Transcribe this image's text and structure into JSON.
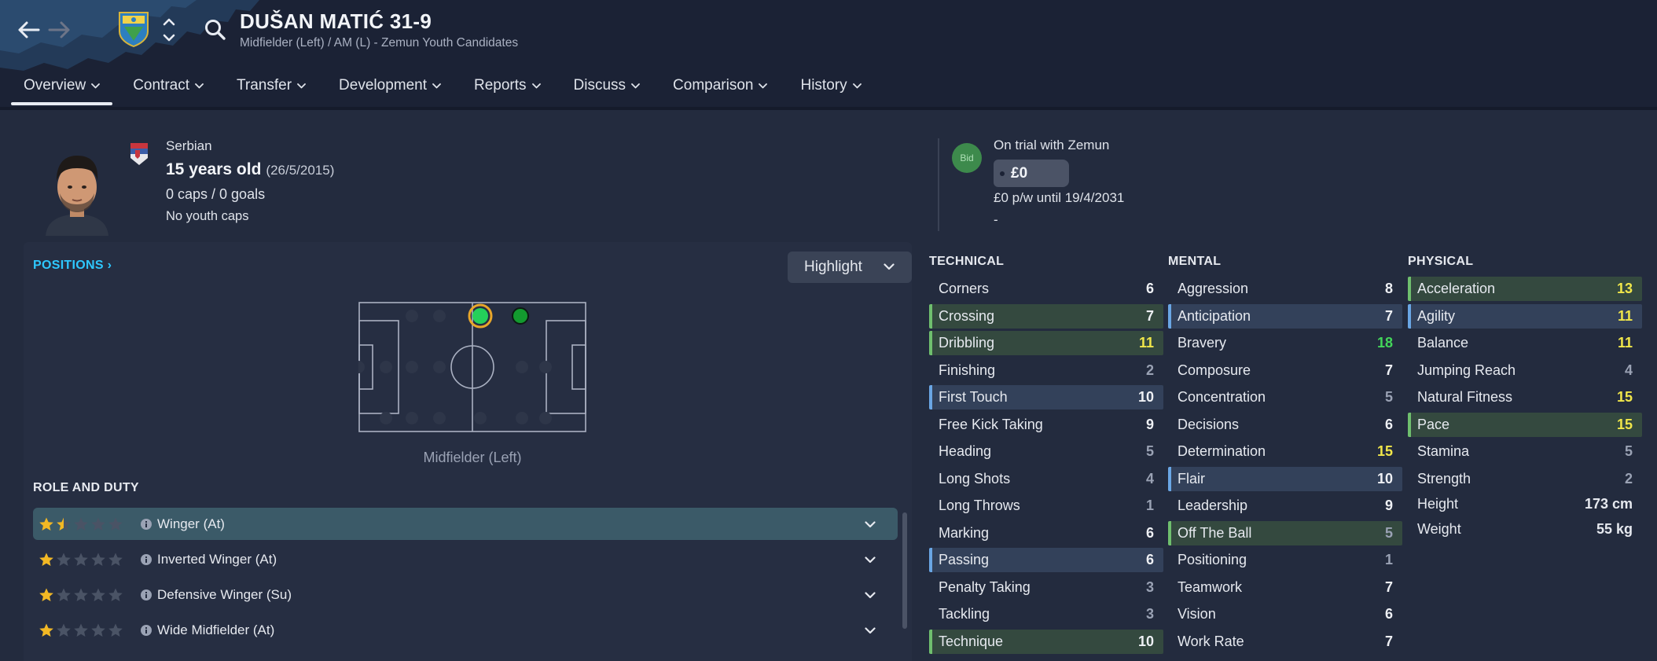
{
  "header": {
    "player_name": "DUŠAN MATIĆ 31-9",
    "subtitle": "Midfielder (Left) / AM (L) - Zemun Youth Candidates",
    "tabs": [
      {
        "label": "Overview",
        "active": true
      },
      {
        "label": "Contract"
      },
      {
        "label": "Transfer"
      },
      {
        "label": "Development"
      },
      {
        "label": "Reports"
      },
      {
        "label": "Discuss"
      },
      {
        "label": "Comparison"
      },
      {
        "label": "History"
      }
    ]
  },
  "profile": {
    "nationality": "Serbian",
    "age": "15 years old",
    "dob": "(26/5/2015)",
    "caps": "0 caps / 0 goals",
    "youth_caps": "No youth caps"
  },
  "contract": {
    "bid_label": "Bid",
    "status": "On trial with Zemun",
    "fee": "£0",
    "wage": "£0 p/w until 19/4/2031",
    "extra": "-"
  },
  "positions": {
    "title": "POSITIONS",
    "highlight_label": "Highlight",
    "current_position": "Midfielder (Left)"
  },
  "role_duty": {
    "title": "ROLE AND DUTY",
    "roles": [
      {
        "name": "Winger (At)",
        "stars": 1.5,
        "selected": true
      },
      {
        "name": "Inverted Winger (At)",
        "stars": 1
      },
      {
        "name": "Defensive Winger (Su)",
        "stars": 1
      },
      {
        "name": "Wide Midfielder (At)",
        "stars": 1
      }
    ]
  },
  "attributes": {
    "technical": {
      "title": "TECHNICAL",
      "items": [
        {
          "name": "Corners",
          "value": "6",
          "tone": "mid",
          "hl": ""
        },
        {
          "name": "Crossing",
          "value": "7",
          "tone": "mid",
          "hl": "green"
        },
        {
          "name": "Dribbling",
          "value": "11",
          "tone": "good",
          "hl": "green"
        },
        {
          "name": "Finishing",
          "value": "2",
          "tone": "low",
          "hl": ""
        },
        {
          "name": "First Touch",
          "value": "10",
          "tone": "mid",
          "hl": "blue"
        },
        {
          "name": "Free Kick Taking",
          "value": "9",
          "tone": "mid",
          "hl": ""
        },
        {
          "name": "Heading",
          "value": "5",
          "tone": "low",
          "hl": ""
        },
        {
          "name": "Long Shots",
          "value": "4",
          "tone": "low",
          "hl": ""
        },
        {
          "name": "Long Throws",
          "value": "1",
          "tone": "low",
          "hl": ""
        },
        {
          "name": "Marking",
          "value": "6",
          "tone": "mid",
          "hl": ""
        },
        {
          "name": "Passing",
          "value": "6",
          "tone": "mid",
          "hl": "blue"
        },
        {
          "name": "Penalty Taking",
          "value": "3",
          "tone": "low",
          "hl": ""
        },
        {
          "name": "Tackling",
          "value": "3",
          "tone": "low",
          "hl": ""
        },
        {
          "name": "Technique",
          "value": "10",
          "tone": "mid",
          "hl": "green"
        }
      ]
    },
    "mental": {
      "title": "MENTAL",
      "items": [
        {
          "name": "Aggression",
          "value": "8",
          "tone": "mid",
          "hl": ""
        },
        {
          "name": "Anticipation",
          "value": "7",
          "tone": "mid",
          "hl": "blue"
        },
        {
          "name": "Bravery",
          "value": "18",
          "tone": "great",
          "hl": ""
        },
        {
          "name": "Composure",
          "value": "7",
          "tone": "mid",
          "hl": ""
        },
        {
          "name": "Concentration",
          "value": "5",
          "tone": "low",
          "hl": ""
        },
        {
          "name": "Decisions",
          "value": "6",
          "tone": "mid",
          "hl": ""
        },
        {
          "name": "Determination",
          "value": "15",
          "tone": "good",
          "hl": ""
        },
        {
          "name": "Flair",
          "value": "10",
          "tone": "mid",
          "hl": "blue"
        },
        {
          "name": "Leadership",
          "value": "9",
          "tone": "mid",
          "hl": ""
        },
        {
          "name": "Off The Ball",
          "value": "5",
          "tone": "low",
          "hl": "green"
        },
        {
          "name": "Positioning",
          "value": "1",
          "tone": "low",
          "hl": ""
        },
        {
          "name": "Teamwork",
          "value": "7",
          "tone": "mid",
          "hl": ""
        },
        {
          "name": "Vision",
          "value": "6",
          "tone": "mid",
          "hl": ""
        },
        {
          "name": "Work Rate",
          "value": "7",
          "tone": "mid",
          "hl": ""
        }
      ]
    },
    "physical": {
      "title": "PHYSICAL",
      "items": [
        {
          "name": "Acceleration",
          "value": "13",
          "tone": "good",
          "hl": "green"
        },
        {
          "name": "Agility",
          "value": "11",
          "tone": "good",
          "hl": "blue"
        },
        {
          "name": "Balance",
          "value": "11",
          "tone": "good",
          "hl": ""
        },
        {
          "name": "Jumping Reach",
          "value": "4",
          "tone": "low",
          "hl": ""
        },
        {
          "name": "Natural Fitness",
          "value": "15",
          "tone": "good",
          "hl": ""
        },
        {
          "name": "Pace",
          "value": "15",
          "tone": "good",
          "hl": "green"
        },
        {
          "name": "Stamina",
          "value": "5",
          "tone": "low",
          "hl": ""
        },
        {
          "name": "Strength",
          "value": "2",
          "tone": "low",
          "hl": ""
        }
      ],
      "height_label": "Height",
      "height": "173 cm",
      "weight_label": "Weight",
      "weight": "55 kg"
    }
  },
  "colors": {
    "accent": "#2ec8ff",
    "good": "#f0e64a",
    "great": "#43d65a",
    "highlight_green": "#6fbf6e",
    "highlight_blue": "#6aa6e4"
  },
  "icons": {
    "back": "arrow-left-icon",
    "forward": "arrow-right-icon",
    "crest": "club-crest-icon",
    "updown": "up-down-chevron-icon",
    "search": "search-icon",
    "flag": "serbia-flag-icon",
    "info": "info-icon",
    "star": "star-icon"
  }
}
